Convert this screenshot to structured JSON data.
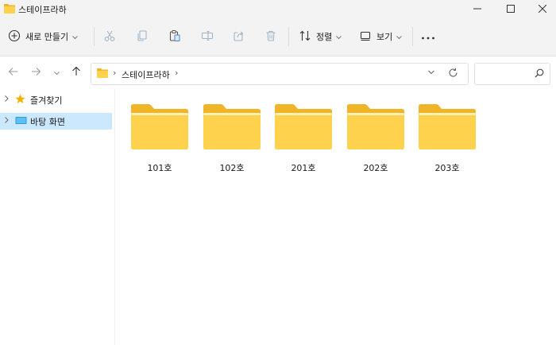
{
  "window": {
    "title": "스테이프라하"
  },
  "toolbar": {
    "new_label": "새로 만들기",
    "sort_label": "정렬",
    "view_label": "보기"
  },
  "address": {
    "crumb": "스테이프라하",
    "separator": "›"
  },
  "search": {
    "placeholder": ""
  },
  "nav": {
    "items": [
      {
        "label": "즐겨찾기",
        "icon": "star-icon",
        "selected": false
      },
      {
        "label": "바탕 화면",
        "icon": "desktop-icon",
        "selected": true
      }
    ]
  },
  "folders": [
    {
      "name": "101호"
    },
    {
      "name": "102호"
    },
    {
      "name": "201호"
    },
    {
      "name": "202호"
    },
    {
      "name": "203호"
    }
  ],
  "colors": {
    "folder_back": "#f0b428",
    "folder_front": "#ffd24d",
    "selection": "#cce8ff",
    "star": "#f2b200",
    "desktop": "#2b9ad8"
  }
}
